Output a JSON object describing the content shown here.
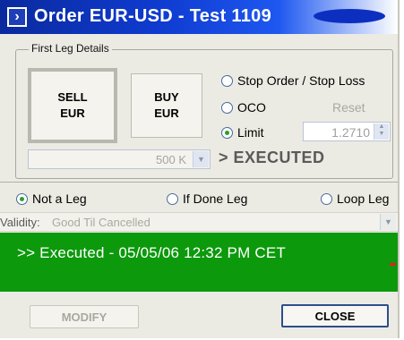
{
  "window": {
    "title": "Order EUR-USD -  Test 1109"
  },
  "first_leg": {
    "legend": "First Leg Details",
    "sell_label_1": "SELL",
    "sell_label_2": "EUR",
    "buy_label_1": "BUY",
    "buy_label_2": "EUR",
    "order_types": [
      {
        "label": "Stop Order / Stop Loss",
        "selected": false
      },
      {
        "label": "OCO",
        "selected": false
      },
      {
        "label": "Limit",
        "selected": true
      }
    ],
    "reset_label": "Reset",
    "limit_value": "1.2710",
    "amount_value": "500 K",
    "executed_label": "> EXECUTED"
  },
  "leg_options": [
    {
      "label": "Not a Leg",
      "selected": true
    },
    {
      "label": "If Done Leg",
      "selected": false
    },
    {
      "label": "Loop Leg",
      "selected": false
    }
  ],
  "validity": {
    "label": "Validity:",
    "value": "Good Til Cancelled"
  },
  "status": {
    "message": ">> Executed - 05/05/06 12:32 PM CET"
  },
  "buttons": {
    "modify": "MODIFY",
    "close": "CLOSE"
  },
  "colors": {
    "titlebar": "#0f3bd0",
    "status_bg": "#0c990c",
    "window_bg": "#ecebe3"
  }
}
